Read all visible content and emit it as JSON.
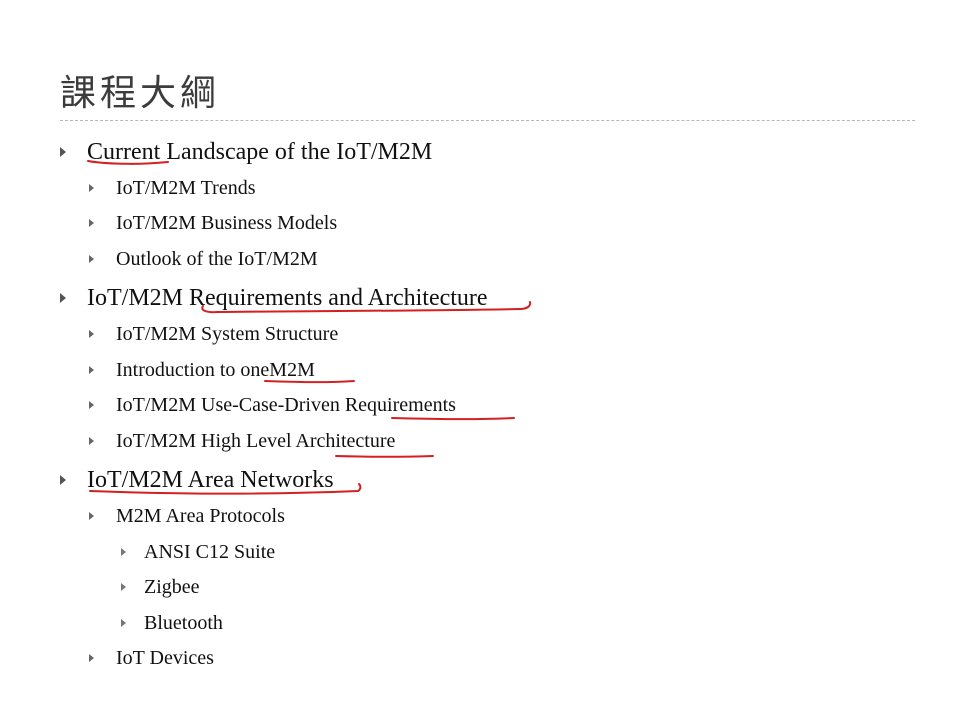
{
  "slide": {
    "title": "課程大綱",
    "items": [
      {
        "text": "Current Landscape of the IoT/M2M",
        "level": 1
      },
      {
        "text": "IoT/M2M Trends",
        "level": 2
      },
      {
        "text": "IoT/M2M Business Models",
        "level": 2
      },
      {
        "text": "Outlook of the IoT/M2M",
        "level": 2
      },
      {
        "text": "IoT/M2M Requirements and Architecture",
        "level": 1
      },
      {
        "text": "IoT/M2M System Structure",
        "level": 2
      },
      {
        "text": "Introduction to oneM2M",
        "level": 2
      },
      {
        "text": "IoT/M2M Use-Case-Driven Requirements",
        "level": 2
      },
      {
        "text": "IoT/M2M High Level Architecture",
        "level": 2
      },
      {
        "text": "IoT/M2M Area Networks",
        "level": 1
      },
      {
        "text": "M2M Area Protocols",
        "level": 2
      },
      {
        "text": "ANSI C12 Suite",
        "level": 3
      },
      {
        "text": "Zigbee",
        "level": 3
      },
      {
        "text": "Bluetooth",
        "level": 3
      },
      {
        "text": "IoT Devices",
        "level": 2
      }
    ],
    "annotation_color": "#d42020",
    "bullet_icon": "triangle-right-icon"
  }
}
